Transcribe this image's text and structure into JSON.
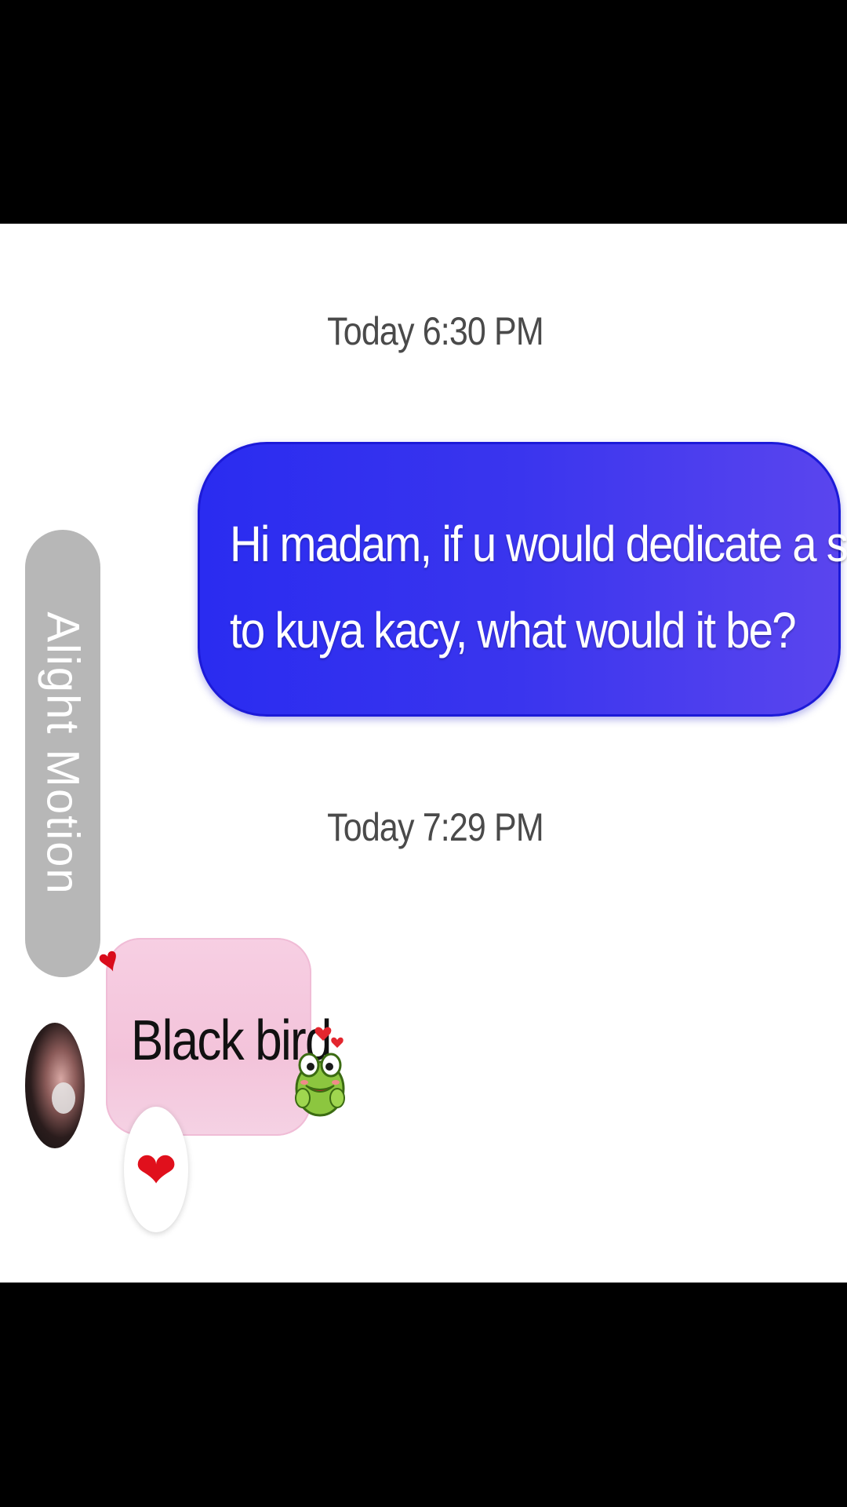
{
  "conversation": {
    "timestamps": [
      "Today 6:30 PM",
      "Today 7:29 PM"
    ],
    "sent_message": {
      "line1": "Hi madam, if u would dedicate a song",
      "line2": "to kuya kacy, what would it be?"
    },
    "received_message": {
      "text": "Black bird",
      "reaction": "❤",
      "decor_heart": "♥"
    }
  },
  "watermark": {
    "text": "Alight Motion"
  },
  "icons": {
    "avatar": "avatar-photo",
    "sticker": "frog-sticker-icon",
    "reaction": "heart-reaction-icon"
  },
  "colors": {
    "sent_bubble": "#3a35ee",
    "received_bubble": "#f5cde1",
    "reaction_heart": "#e0101c",
    "watermark_bg": "#b7b7b7"
  }
}
